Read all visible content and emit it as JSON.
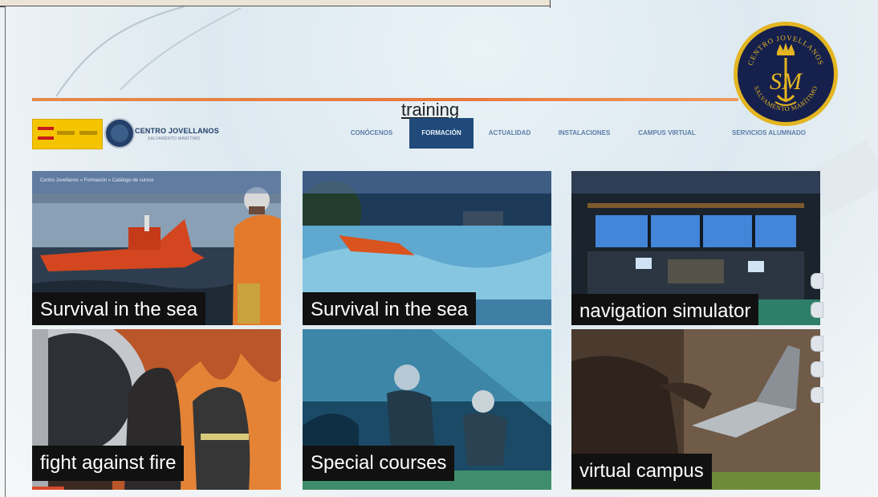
{
  "header": {
    "section_title": "training",
    "logo_name": "CENTRO JOVELLANOS",
    "logo_subtitle": "SALVAMENTO MARÍTIMO"
  },
  "nav": {
    "items": [
      {
        "label": "CONÓCENOS",
        "active": false
      },
      {
        "label": "FORMACIÓN",
        "active": true
      },
      {
        "label": "ACTUALIDAD",
        "active": false
      },
      {
        "label": "INSTALACIONES",
        "active": false
      },
      {
        "label": "CAMPUS VIRTUAL",
        "active": false
      },
      {
        "label": "SERVICIOS ALUMNADO",
        "active": false
      }
    ]
  },
  "breadcrumb": "Centro Jovellanos » Formación » Catálogo de cursos",
  "seal": {
    "text_top": "CENTRO JOVELLANOS",
    "monogram": "SM",
    "text_bottom": "SALVAMENTO MARÍTIMO"
  },
  "tiles": [
    {
      "label": "Survival in the sea"
    },
    {
      "label": "Survival in the sea"
    },
    {
      "label": "navigation simulator"
    },
    {
      "label": "fight against fire"
    },
    {
      "label": "Special courses"
    },
    {
      "label": "virtual campus"
    }
  ],
  "colors": {
    "accent_orange": "#e8773a",
    "nav_active_bg": "#1f4a7a",
    "nav_text": "#5d7ea8",
    "seal_gold": "#e3b521",
    "seal_navy": "#16204c",
    "label_bg": "#111111"
  },
  "icons": [
    "spain-government-logo",
    "jovellanos-emblem-icon",
    "salvamento-maritimo-seal",
    "search-icon",
    "mail-icon",
    "share-icon"
  ]
}
